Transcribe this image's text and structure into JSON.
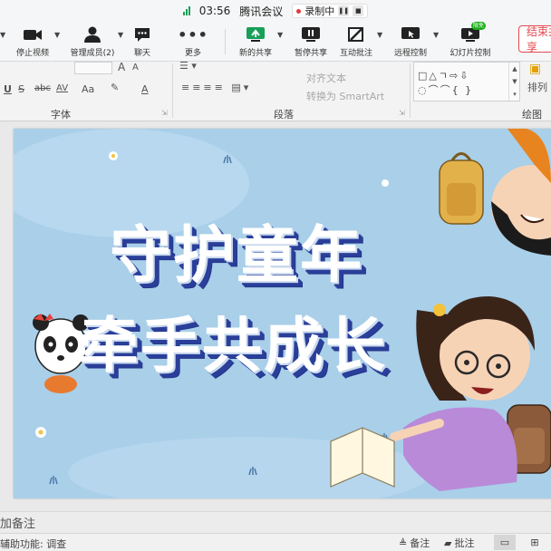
{
  "meeting": {
    "time": "03:56",
    "app_name": "腾讯会议",
    "recording_label": "录制中",
    "toolbar": [
      {
        "label": "停止视频",
        "icon": "camera-icon"
      },
      {
        "label": "管理成员(2)",
        "icon": "members-icon"
      },
      {
        "label": "聊天",
        "icon": "chat-icon"
      },
      {
        "label": "更多",
        "icon": "more-icon"
      },
      {
        "label": "新的共享",
        "icon": "share-icon"
      },
      {
        "label": "暂停共享",
        "icon": "pause-share-icon"
      },
      {
        "label": "互动批注",
        "icon": "annotate-icon"
      },
      {
        "label": "远程控制",
        "icon": "remote-control-icon"
      },
      {
        "label": "幻灯片控制",
        "icon": "slide-control-icon",
        "badge": "限免"
      }
    ],
    "end_button": "结束共享",
    "colors": {
      "accent_green": "#18a058",
      "end_red": "#e5484d"
    }
  },
  "ribbon": {
    "font_group_label": "字体",
    "paragraph_group_label": "段落",
    "drawing_group_label": "绘图",
    "font_size_grow": "A",
    "font_size_shrink": "A",
    "underline": "U",
    "strike": "S",
    "strike_abc": "abc",
    "char_spacing": "AV",
    "change_case": "Aa",
    "font_color": "A",
    "align_text": "对齐文本",
    "convert_smartart": "转换为 SmartArt",
    "arrange": "排列"
  },
  "slide": {
    "title_line_1": "守护童年",
    "title_line_2": "牵手共成长",
    "colors": {
      "background": "#a9cfe9",
      "title_shadow": "#2a3f9a"
    }
  },
  "notes_placeholder": "加备注",
  "statusbar": {
    "accessibility": "辅助功能: 调查",
    "notes_button": "备注",
    "comments_button": "批注"
  }
}
